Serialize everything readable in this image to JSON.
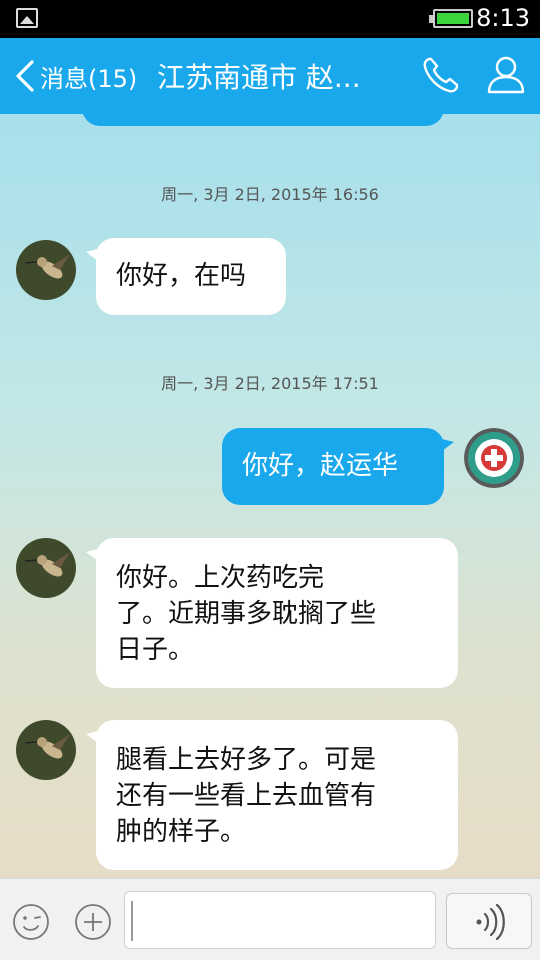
{
  "status_bar": {
    "time": "8:13"
  },
  "header": {
    "back_label": "消息(15)",
    "title": "江苏南通市 赵...",
    "accent_color": "#1aa8ec"
  },
  "messages": [
    {
      "type": "timestamp",
      "text": "周一, 3月 2日, 2015年 16:56"
    },
    {
      "type": "bubble",
      "direction": "in",
      "text": "你好，在吗",
      "avatar": "hummingbird-avatar"
    },
    {
      "type": "timestamp",
      "text": "周一, 3月 2日, 2015年 17:51"
    },
    {
      "type": "bubble",
      "direction": "out",
      "text": "你好，赵运华",
      "avatar": "clinic-logo-avatar"
    },
    {
      "type": "bubble",
      "direction": "in",
      "lines": [
        "你好。上次药吃完",
        "了。近期事多耽搁了些",
        "日子。"
      ],
      "avatar": "hummingbird-avatar"
    },
    {
      "type": "bubble",
      "direction": "in",
      "lines": [
        "腿看上去好多了。可是",
        "还有一些看上去血管有",
        "肿的样子。"
      ],
      "avatar": "hummingbird-avatar"
    }
  ],
  "input_bar": {
    "value": "",
    "icons": [
      "smiley-icon",
      "plus-icon",
      "voice-icon"
    ]
  }
}
